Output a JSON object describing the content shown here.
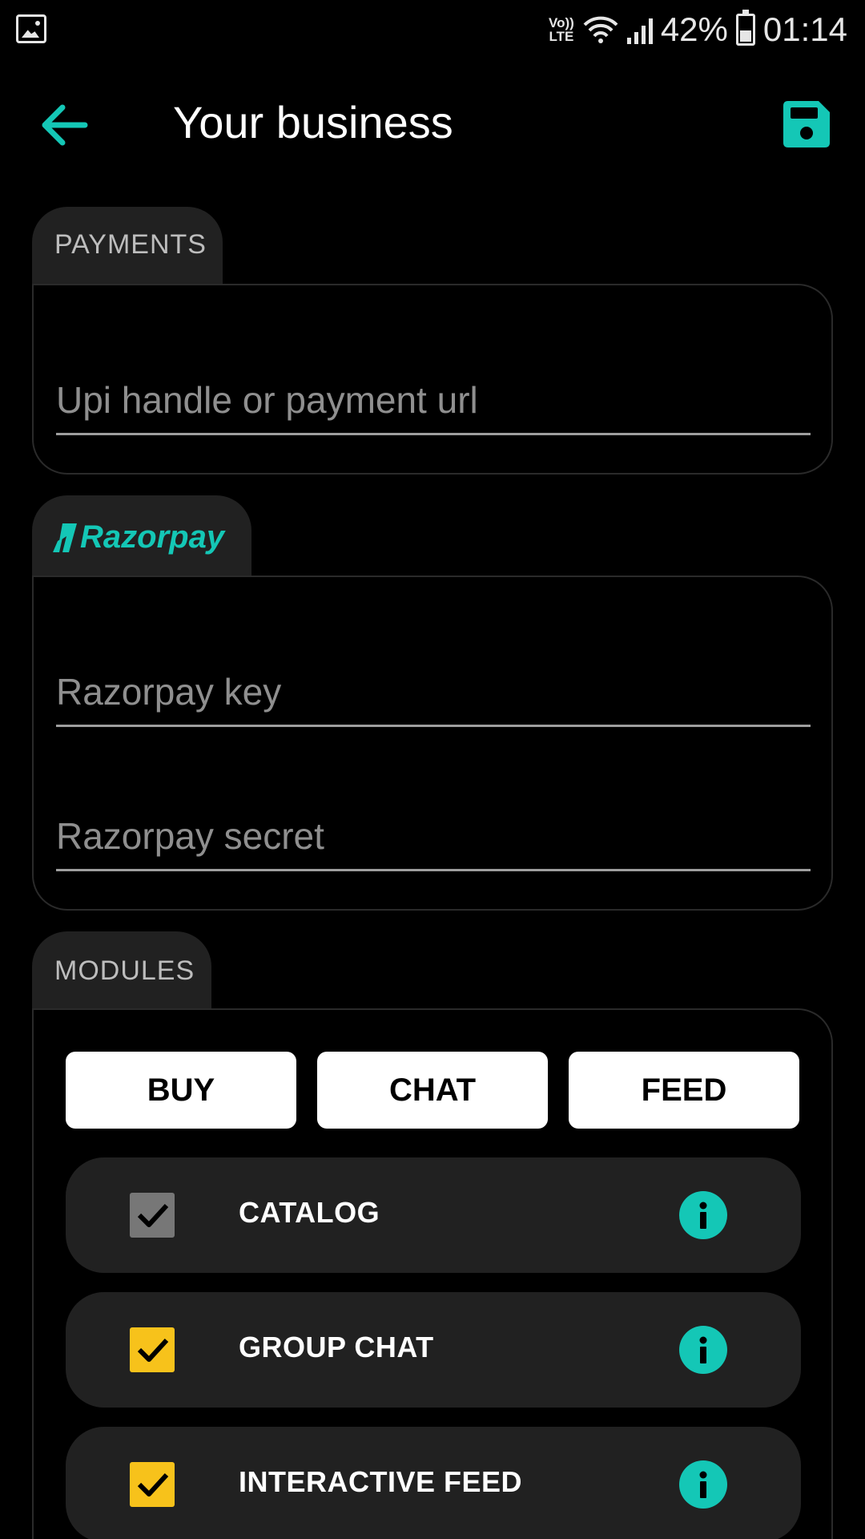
{
  "status_bar": {
    "network_label": "Vo)) LTE",
    "battery": "42%",
    "time": "01:14"
  },
  "header": {
    "title": "Your business"
  },
  "payments": {
    "tab_label": "PAYMENTS",
    "upi_placeholder": "Upi handle or payment url",
    "upi_value": ""
  },
  "razorpay": {
    "logo_text": "Razorpay",
    "key_placeholder": "Razorpay key",
    "secret_placeholder": "Razorpay secret"
  },
  "modules": {
    "tab_label": "MODULES",
    "buttons": [
      "BUY",
      "CHAT",
      "FEED"
    ],
    "items": [
      {
        "label": "CATALOG",
        "checked": true,
        "disabled": true
      },
      {
        "label": "GROUP CHAT",
        "checked": true,
        "disabled": false
      },
      {
        "label": "INTERACTIVE FEED",
        "checked": true,
        "disabled": false
      }
    ]
  },
  "colors": {
    "accent": "#14c7b6",
    "checkbox_active": "#f7c21b",
    "checkbox_disabled": "#777777",
    "card": "#212121"
  }
}
